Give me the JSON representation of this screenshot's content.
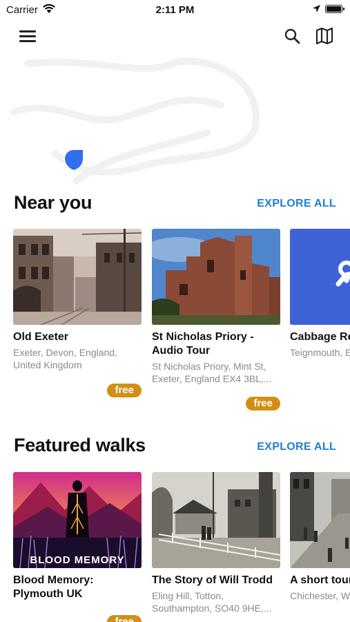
{
  "status_bar": {
    "carrier": "Carrier",
    "time": "2:11 PM"
  },
  "toolbar": {
    "menu_icon": "hamburger-menu-icon",
    "search_icon": "search-icon",
    "map_icon": "map-icon"
  },
  "sections": [
    {
      "title": "Near you",
      "explore_label": "EXPLORE ALL",
      "cards": [
        {
          "title": "Old Exeter",
          "subtitle": "Exeter, Devon, England, United Kingdom",
          "badge": "free"
        },
        {
          "title": "St Nicholas Priory - Audio Tour",
          "subtitle": "St Nicholas Priory, Mint St, Exeter, England EX4 3BL,...",
          "badge": "free"
        },
        {
          "title": "Cabbage Re",
          "subtitle": "Teignmouth, E England, Unite"
        }
      ]
    },
    {
      "title": "Featured walks",
      "explore_label": "EXPLORE ALL",
      "cards": [
        {
          "title": "Blood Memory: Plymouth UK",
          "thumb_text": "BLOOD MEMORY",
          "badge": "free"
        },
        {
          "title": "The Story of Will Trodd",
          "subtitle": "Eling Hill, Totton, Southampton, SO40 9HE,..."
        },
        {
          "title": "A short tour of Chichest",
          "subtitle": "Chichester, W England, Unit"
        }
      ]
    }
  ],
  "colors": {
    "accent": "#1f7fd1",
    "badge": "#d28f14",
    "pin": "#2f6ff0"
  }
}
